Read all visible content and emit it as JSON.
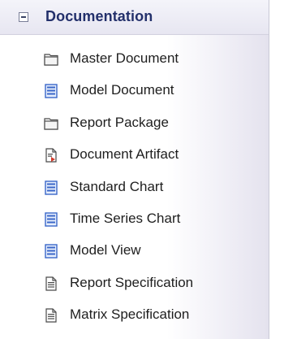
{
  "toolbox": {
    "section": {
      "title": "Documentation",
      "expanded": true
    },
    "items": [
      {
        "label": "Master Document",
        "icon": "folder-document-icon"
      },
      {
        "label": "Model Document",
        "icon": "model-document-icon"
      },
      {
        "label": "Report Package",
        "icon": "folder-document-icon"
      },
      {
        "label": "Document Artifact",
        "icon": "document-artifact-icon"
      },
      {
        "label": "Standard Chart",
        "icon": "chart-icon"
      },
      {
        "label": "Time Series Chart",
        "icon": "chart-icon"
      },
      {
        "label": "Model View",
        "icon": "model-view-icon"
      },
      {
        "label": "Report Specification",
        "icon": "specification-icon"
      },
      {
        "label": "Matrix Specification",
        "icon": "specification-icon"
      }
    ],
    "colors": {
      "header_text": "#23306b",
      "doc_icon_blue": "#3a67c9",
      "artifact_red": "#d23a2a"
    }
  }
}
